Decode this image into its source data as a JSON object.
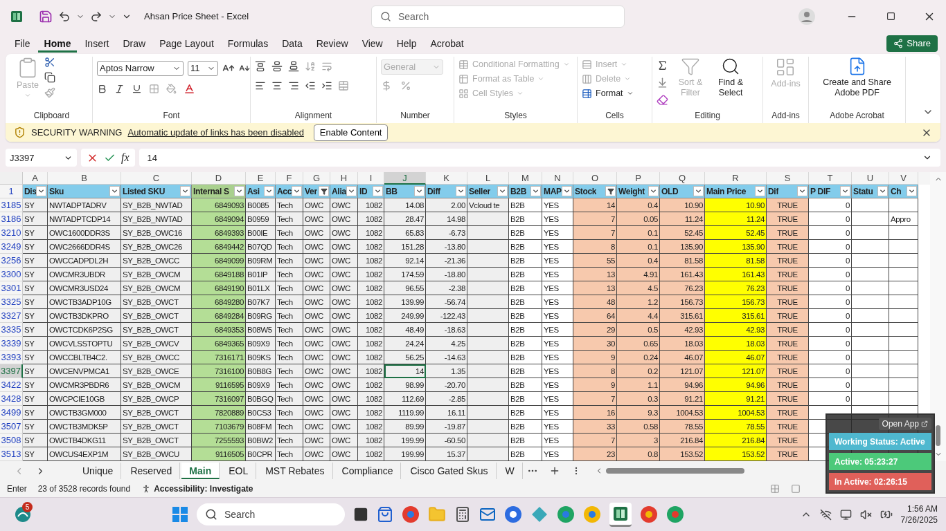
{
  "title_bar": {
    "title": "Ahsan Price Sheet  -  Excel",
    "search_placeholder": "Search"
  },
  "menu": {
    "tabs": [
      {
        "label": "File",
        "selected": false
      },
      {
        "label": "Home",
        "selected": true
      },
      {
        "label": "Insert",
        "selected": false
      },
      {
        "label": "Draw",
        "selected": false
      },
      {
        "label": "Page Layout",
        "selected": false
      },
      {
        "label": "Formulas",
        "selected": false
      },
      {
        "label": "Data",
        "selected": false
      },
      {
        "label": "Review",
        "selected": false
      },
      {
        "label": "View",
        "selected": false
      },
      {
        "label": "Help",
        "selected": false
      },
      {
        "label": "Acrobat",
        "selected": false
      }
    ],
    "share": "Share"
  },
  "ribbon": {
    "clipboard": {
      "label": "Clipboard",
      "paste": {
        "label": "Paste",
        "disabled": true
      }
    },
    "font": {
      "label": "Font",
      "font_name": "Aptos Narrow",
      "font_size": "11"
    },
    "alignment": {
      "label": "Alignment"
    },
    "number": {
      "label": "Number",
      "format": {
        "value": "General",
        "disabled": true
      }
    },
    "styles": {
      "label": "Styles",
      "items": [
        {
          "label": "Conditional Formatting",
          "disabled": true
        },
        {
          "label": "Format as Table",
          "disabled": true
        },
        {
          "label": "Cell Styles",
          "disabled": true
        }
      ]
    },
    "cells": {
      "label": "Cells",
      "items": [
        {
          "label": "Insert",
          "disabled": true
        },
        {
          "label": "Delete",
          "disabled": true
        },
        {
          "label": "Format",
          "disabled": false
        }
      ]
    },
    "editing": {
      "label": "Editing",
      "items": [
        {
          "label": "Sort & Filter",
          "disabled": true
        },
        {
          "label": "Find & Select",
          "disabled": false
        }
      ]
    },
    "addins": {
      "label": "Add-ins",
      "button": {
        "label": "Add-ins",
        "disabled": true
      }
    },
    "acrobat": {
      "label": "Adobe Acrobat",
      "button": {
        "label": "Create and Share Adobe PDF",
        "disabled": false
      }
    }
  },
  "security_bar": {
    "title": "SECURITY WARNING",
    "message": "Automatic update of links has been disabled",
    "button": "Enable Content"
  },
  "formula_bar": {
    "name_box": "J3397",
    "fx_label": "fx",
    "value": "14"
  },
  "sheet": {
    "columns": [
      {
        "letter": "A",
        "header": "Dis",
        "color": "#efefef",
        "filtered": false,
        "selected": false
      },
      {
        "letter": "B",
        "header": "Sku",
        "color": "#efefef",
        "filtered": false,
        "selected": false
      },
      {
        "letter": "C",
        "header": "Listed SKU",
        "color": "#efefef",
        "filtered": false,
        "selected": false
      },
      {
        "letter": "D",
        "header": "Internal S",
        "color": "#b4de96",
        "filtered": false,
        "selected": false
      },
      {
        "letter": "E",
        "header": "Asi",
        "color": "#efefef",
        "filtered": false,
        "selected": false
      },
      {
        "letter": "F",
        "header": "Acc",
        "color": "#efefef",
        "filtered": false,
        "selected": false
      },
      {
        "letter": "G",
        "header": "Ver",
        "color": "#efefef",
        "filtered": true,
        "selected": false
      },
      {
        "letter": "H",
        "header": "Alia",
        "color": "#efefef",
        "filtered": false,
        "selected": false
      },
      {
        "letter": "I",
        "header": "ID",
        "color": "#efefef",
        "filtered": false,
        "selected": false
      },
      {
        "letter": "J",
        "header": "BB",
        "color": "#efefef",
        "filtered": false,
        "selected": true
      },
      {
        "letter": "K",
        "header": "Diff",
        "color": "#efefef",
        "filtered": false,
        "selected": false
      },
      {
        "letter": "L",
        "header": "Seller",
        "color": "#efefef",
        "filtered": false,
        "selected": false
      },
      {
        "letter": "M",
        "header": "B2B",
        "color": "#ffffff",
        "filtered": false,
        "selected": false
      },
      {
        "letter": "N",
        "header": "MAP",
        "color": "#ffffff",
        "filtered": false,
        "selected": false
      },
      {
        "letter": "O",
        "header": "Stock",
        "color": "#f7c9ad",
        "filtered": true,
        "selected": false
      },
      {
        "letter": "P",
        "header": "Weight",
        "color": "#f7c9ad",
        "filtered": false,
        "selected": false
      },
      {
        "letter": "Q",
        "header": "OLD",
        "color": "#f7c9ad",
        "filtered": false,
        "selected": false
      },
      {
        "letter": "R",
        "header": "Main Price",
        "color": "#ffff00",
        "filtered": false,
        "selected": false
      },
      {
        "letter": "S",
        "header": "Dif",
        "color": "#f7c9ad",
        "filtered": false,
        "selected": false
      },
      {
        "letter": "T",
        "header": "P DIF",
        "color": "#ffffff",
        "filtered": false,
        "selected": false
      },
      {
        "letter": "U",
        "header": "Statu",
        "color": "#ffffff",
        "filtered": false,
        "selected": false
      },
      {
        "letter": "V",
        "header": "Ch",
        "color": "#ffffff",
        "filtered": false,
        "selected": false
      }
    ],
    "header_row": "1",
    "rows": [
      {
        "number": "3185",
        "selected": false,
        "cells": {
          "A": "SY",
          "B": "NWTADPTADRV",
          "C": "SY_B2B_NWTAD",
          "D": "6849093",
          "E": "B0085",
          "F": "Tech",
          "G": "OWC",
          "H": "OWC",
          "I": "1082",
          "J": "14.08",
          "K": "2.00",
          "L": "Vcloud te",
          "M": "B2B",
          "N": "YES",
          "O": "14",
          "P": "0.4",
          "Q": "10.90",
          "R": "10.90",
          "S": "TRUE",
          "T": "0"
        }
      },
      {
        "number": "3186",
        "selected": false,
        "cells": {
          "A": "SY",
          "B": "NWTADPTCDP14",
          "C": "SY_B2B_NWTAD",
          "D": "6849094",
          "E": "B0959",
          "F": "Tech",
          "G": "OWC",
          "H": "OWC",
          "I": "1082",
          "J": "28.47",
          "K": "14.98",
          "M": "B2B",
          "N": "YES",
          "O": "7",
          "P": "0.05",
          "Q": "11.24",
          "R": "11.24",
          "S": "TRUE",
          "T": "0",
          "V": "Appro"
        }
      },
      {
        "number": "3210",
        "selected": false,
        "cells": {
          "A": "SY",
          "B": "OWC1600DDR3S",
          "C": "SY_B2B_OWC16",
          "D": "6849393",
          "E": "B00IE",
          "F": "Tech",
          "G": "OWC",
          "H": "OWC",
          "I": "1082",
          "J": "65.83",
          "K": "-6.73",
          "M": "B2B",
          "N": "YES",
          "O": "7",
          "P": "0.1",
          "Q": "52.45",
          "R": "52.45",
          "S": "TRUE",
          "T": "0"
        }
      },
      {
        "number": "3249",
        "selected": false,
        "cells": {
          "A": "SY",
          "B": "OWC2666DDR4S",
          "C": "SY_B2B_OWC26",
          "D": "6849442",
          "E": "B07QD",
          "F": "Tech",
          "G": "OWC",
          "H": "OWC",
          "I": "1082",
          "J": "151.28",
          "K": "-13.80",
          "M": "B2B",
          "N": "YES",
          "O": "8",
          "P": "0.1",
          "Q": "135.90",
          "R": "135.90",
          "S": "TRUE",
          "T": "0"
        }
      },
      {
        "number": "3256",
        "selected": false,
        "cells": {
          "A": "SY",
          "B": "OWCCADPDL2H",
          "C": "SY_B2B_OWCC",
          "D": "6849099",
          "E": "B09RM",
          "F": "Tech",
          "G": "OWC",
          "H": "OWC",
          "I": "1082",
          "J": "92.14",
          "K": "-21.36",
          "M": "B2B",
          "N": "YES",
          "O": "55",
          "P": "0.4",
          "Q": "81.58",
          "R": "81.58",
          "S": "TRUE",
          "T": "0"
        }
      },
      {
        "number": "3300",
        "selected": false,
        "cells": {
          "A": "SY",
          "B": "OWCMR3UBDR",
          "C": "SY_B2B_OWCM",
          "D": "6849188",
          "E": "B01IP",
          "F": "Tech",
          "G": "OWC",
          "H": "OWC",
          "I": "1082",
          "J": "174.59",
          "K": "-18.80",
          "M": "B2B",
          "N": "YES",
          "O": "13",
          "P": "4.91",
          "Q": "161.43",
          "R": "161.43",
          "S": "TRUE",
          "T": "0"
        }
      },
      {
        "number": "3301",
        "selected": false,
        "cells": {
          "A": "SY",
          "B": "OWCMR3USD24",
          "C": "SY_B2B_OWCM",
          "D": "6849190",
          "E": "B01LX",
          "F": "Tech",
          "G": "OWC",
          "H": "OWC",
          "I": "1082",
          "J": "96.55",
          "K": "-2.38",
          "M": "B2B",
          "N": "YES",
          "O": "13",
          "P": "4.5",
          "Q": "76.23",
          "R": "76.23",
          "S": "TRUE",
          "T": "0"
        }
      },
      {
        "number": "3325",
        "selected": false,
        "cells": {
          "A": "SY",
          "B": "OWCTB3ADP10G",
          "C": "SY_B2B_OWCT",
          "D": "6849280",
          "E": "B07K7",
          "F": "Tech",
          "G": "OWC",
          "H": "OWC",
          "I": "1082",
          "J": "139.99",
          "K": "-56.74",
          "M": "B2B",
          "N": "YES",
          "O": "48",
          "P": "1.2",
          "Q": "156.73",
          "R": "156.73",
          "S": "TRUE",
          "T": "0"
        }
      },
      {
        "number": "3327",
        "selected": false,
        "cells": {
          "A": "SY",
          "B": "OWCTB3DKPRO",
          "C": "SY_B2B_OWCT",
          "D": "6849284",
          "E": "B09RG",
          "F": "Tech",
          "G": "OWC",
          "H": "OWC",
          "I": "1082",
          "J": "249.99",
          "K": "-122.43",
          "M": "B2B",
          "N": "YES",
          "O": "64",
          "P": "4.4",
          "Q": "315.61",
          "R": "315.61",
          "S": "TRUE",
          "T": "0"
        }
      },
      {
        "number": "3335",
        "selected": false,
        "cells": {
          "A": "SY",
          "B": "OWCTCDK6P2SG",
          "C": "SY_B2B_OWCT",
          "D": "6849353",
          "E": "B08W5",
          "F": "Tech",
          "G": "OWC",
          "H": "OWC",
          "I": "1082",
          "J": "48.49",
          "K": "-18.63",
          "M": "B2B",
          "N": "YES",
          "O": "29",
          "P": "0.5",
          "Q": "42.93",
          "R": "42.93",
          "S": "TRUE",
          "T": "0"
        }
      },
      {
        "number": "3339",
        "selected": false,
        "cells": {
          "A": "SY",
          "B": "OWCVLSSTOPTU",
          "C": "SY_B2B_OWCV",
          "D": "6849365",
          "E": "B09X9",
          "F": "Tech",
          "G": "OWC",
          "H": "OWC",
          "I": "1082",
          "J": "24.24",
          "K": "4.25",
          "M": "B2B",
          "N": "YES",
          "O": "30",
          "P": "0.65",
          "Q": "18.03",
          "R": "18.03",
          "S": "TRUE",
          "T": "0"
        }
      },
      {
        "number": "3393",
        "selected": false,
        "cells": {
          "A": "SY",
          "B": "OWCCBLTB4C2.",
          "C": "SY_B2B_OWCC",
          "D": "7316171",
          "E": "B09KS",
          "F": "Tech",
          "G": "OWC",
          "H": "OWC",
          "I": "1082",
          "J": "56.25",
          "K": "-14.63",
          "M": "B2B",
          "N": "YES",
          "O": "9",
          "P": "0.24",
          "Q": "46.07",
          "R": "46.07",
          "S": "TRUE",
          "T": "0"
        }
      },
      {
        "number": "3397",
        "selected": true,
        "cells": {
          "A": "SY",
          "B": "OWCENVPMCA1",
          "C": "SY_B2B_OWCE",
          "D": "7316100",
          "E": "B0B8G",
          "F": "Tech",
          "G": "OWC",
          "H": "OWC",
          "I": "1082",
          "J": "14",
          "K": "1.35",
          "M": "B2B",
          "N": "YES",
          "O": "8",
          "P": "0.2",
          "Q": "121.07",
          "R": "121.07",
          "S": "TRUE",
          "T": "0"
        }
      },
      {
        "number": "3422",
        "selected": false,
        "cells": {
          "A": "SY",
          "B": "OWCMR3PBDR6",
          "C": "SY_B2B_OWCM",
          "D": "9116595",
          "E": "B09X9",
          "F": "Tech",
          "G": "OWC",
          "H": "OWC",
          "I": "1082",
          "J": "98.99",
          "K": "-20.70",
          "M": "B2B",
          "N": "YES",
          "O": "9",
          "P": "1.1",
          "Q": "94.96",
          "R": "94.96",
          "S": "TRUE",
          "T": "0"
        }
      },
      {
        "number": "3428",
        "selected": false,
        "cells": {
          "A": "SY",
          "B": "OWCPCIE10GB",
          "C": "SY_B2B_OWCP",
          "D": "7316097",
          "E": "B0BGQ",
          "F": "Tech",
          "G": "OWC",
          "H": "OWC",
          "I": "1082",
          "J": "112.69",
          "K": "-2.85",
          "M": "B2B",
          "N": "YES",
          "O": "7",
          "P": "0.3",
          "Q": "91.21",
          "R": "91.21",
          "S": "TRUE",
          "T": "0"
        }
      },
      {
        "number": "3499",
        "selected": false,
        "cells": {
          "A": "SY",
          "B": "OWCTB3GM000",
          "C": "SY_B2B_OWCT",
          "D": "7820889",
          "E": "B0CS3",
          "F": "Tech",
          "G": "OWC",
          "H": "OWC",
          "I": "1082",
          "J": "1119.99",
          "K": "16.11",
          "M": "B2B",
          "N": "YES",
          "O": "16",
          "P": "9.3",
          "Q": "1004.53",
          "R": "1004.53",
          "S": "TRUE"
        }
      },
      {
        "number": "3507",
        "selected": false,
        "cells": {
          "A": "SY",
          "B": "OWCTB3MDK5P",
          "C": "SY_B2B_OWCT",
          "D": "7103679",
          "E": "B08FM",
          "F": "Tech",
          "G": "OWC",
          "H": "OWC",
          "I": "1082",
          "J": "89.99",
          "K": "-19.87",
          "M": "B2B",
          "N": "YES",
          "O": "33",
          "P": "0.58",
          "Q": "78.55",
          "R": "78.55",
          "S": "TRUE"
        }
      },
      {
        "number": "3508",
        "selected": false,
        "cells": {
          "A": "SY",
          "B": "OWCTB4DKG11",
          "C": "SY_B2B_OWCT",
          "D": "7255593",
          "E": "B0BW2",
          "F": "Tech",
          "G": "OWC",
          "H": "OWC",
          "I": "1082",
          "J": "199.99",
          "K": "-60.50",
          "M": "B2B",
          "N": "YES",
          "O": "7",
          "P": "3",
          "Q": "216.84",
          "R": "216.84",
          "S": "TRUE"
        }
      },
      {
        "number": "3513",
        "selected": false,
        "cells": {
          "A": "SY",
          "B": "OWCUS4EXP1M",
          "C": "SY_B2B_OWCU",
          "D": "9116505",
          "E": "B0CPR",
          "F": "Tech",
          "G": "OWC",
          "H": "OWC",
          "I": "1082",
          "J": "199.99",
          "K": "15.37",
          "M": "B2B",
          "N": "YES",
          "O": "23",
          "P": "0.8",
          "Q": "153.52",
          "R": "153.52",
          "S": "TRUE"
        }
      }
    ]
  },
  "sheet_tabs": [
    {
      "label": "Unique",
      "selected": false
    },
    {
      "label": "Reserved",
      "selected": false
    },
    {
      "label": "Main",
      "selected": true
    },
    {
      "label": "EOL",
      "selected": false
    },
    {
      "label": "MST Rebates",
      "selected": false
    },
    {
      "label": "Compliance",
      "selected": false
    },
    {
      "label": "Cisco Gated Skus",
      "selected": false
    },
    {
      "label": "W",
      "selected": false
    }
  ],
  "status_bar": {
    "mode": "Enter",
    "records": "23 of 3528 records found",
    "accessibility": "Accessibility: Investigate"
  },
  "status_widget": {
    "open_app": "Open App",
    "items": [
      {
        "label": "Working Status: Active",
        "color": "#4fb8cf"
      },
      {
        "label": "Active: 05:23:27",
        "color": "#4cc97a"
      },
      {
        "label": "In Active: 02:26:15",
        "color": "#e0605a"
      }
    ]
  },
  "taskbar": {
    "badge": "5",
    "search_placeholder": "Search",
    "time": "1:56 AM",
    "date": "7/26/2025"
  }
}
